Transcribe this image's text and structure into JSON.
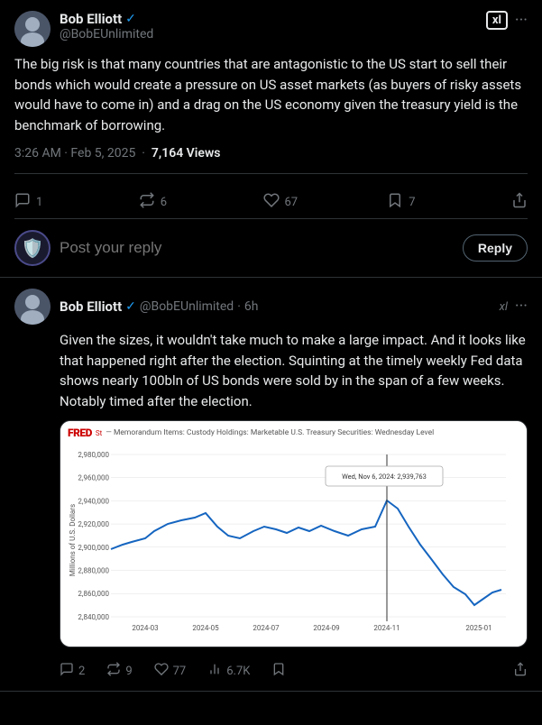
{
  "tweet1": {
    "display_name": "Bob Elliott",
    "username": "@BobEUnlimited",
    "verified": true,
    "xl_label": "xl",
    "body": "The big risk is that many countries that are antagonistic to the US start to sell their bonds which would create a pressure on US asset markets (as buyers of risky assets would have to come in) and a drag on the US economy given the treasury yield is the benchmark of borrowing.",
    "timestamp": "3:26 AM · Feb 5, 2025",
    "views_label": "7,164 Views",
    "stats": {
      "replies": "1",
      "retweets": "6",
      "likes": "67",
      "bookmarks": "7"
    },
    "reply_placeholder": "Post your reply",
    "reply_button": "Reply"
  },
  "tweet2": {
    "display_name": "Bob Elliott",
    "username": "@BobEUnlimited",
    "verified": true,
    "time_ago": "6h",
    "xl_label": "xl",
    "body": "Given the sizes, it wouldn't take much to make a large impact.  And it looks like that happened right after the election.  Squinting at the timely weekly Fed data shows nearly 100bln of US bonds were sold by in the span of a few weeks.  Notably timed after the election.",
    "chart": {
      "fred_label": "FRED",
      "fred_sub": "St",
      "title": "— Memorandum Items: Custody Holdings: Marketable U.S. Treasury Securities: Wednesday Level",
      "annotation": "Wed, Nov 6, 2024:  2,939,763",
      "y_axis_label": "Millions of U.S. Dollars",
      "y_labels": [
        "2,980,000",
        "2,960,000",
        "2,940,000",
        "2,920,000",
        "2,900,000",
        "2,880,000",
        "2,860,000",
        "2,840,000"
      ],
      "x_labels": [
        "2024-03",
        "2024-05",
        "2024-07",
        "2024-09",
        "2024-11",
        "2025-01"
      ]
    },
    "stats": {
      "replies": "2",
      "retweets": "9",
      "likes": "77",
      "views": "6.7K"
    }
  },
  "icons": {
    "reply": "💬",
    "retweet": "🔁",
    "like": "🤍",
    "bookmark": "🔖",
    "share": "⬆",
    "more": "···",
    "verified_color": "#1d9bf0",
    "bar_chart": "📊"
  }
}
